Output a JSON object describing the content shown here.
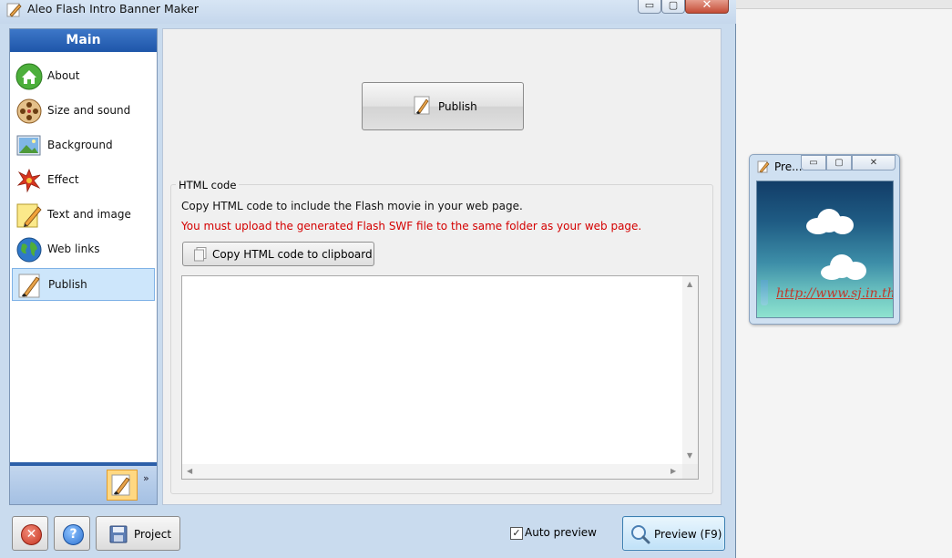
{
  "window": {
    "title": "Aleo Flash Intro Banner Maker",
    "min_glyph": "▭",
    "max_glyph": "▢",
    "close_glyph": "✕"
  },
  "nav": {
    "header": "Main",
    "items": [
      {
        "label": "About",
        "icon": "home-icon"
      },
      {
        "label": "Size and sound",
        "icon": "film-reel-icon"
      },
      {
        "label": "Background",
        "icon": "picture-icon"
      },
      {
        "label": "Effect",
        "icon": "splash-icon"
      },
      {
        "label": "Text and image",
        "icon": "pencil-note-icon"
      },
      {
        "label": "Web links",
        "icon": "globe-icon"
      },
      {
        "label": "Publish",
        "icon": "brush-icon",
        "selected": true
      }
    ],
    "chevron": "»"
  },
  "content": {
    "publish_label": "Publish",
    "html_group_title": "HTML code",
    "copy_instruction": "Copy HTML code to include the Flash movie in your web page.",
    "upload_warning": "You must upload the generated Flash SWF file to the same folder as your web page.",
    "copy_button_label": "Copy HTML code to clipboard",
    "code_text": ""
  },
  "bottom": {
    "project_label": "Project",
    "auto_preview_label": "Auto preview",
    "auto_preview_checked": true,
    "preview_label": "Preview (F9)",
    "exit_glyph": "✕",
    "help_glyph": "?"
  },
  "preview_window": {
    "title": "Pre...",
    "link_text": "http://www.sj.in.th"
  },
  "colors": {
    "nav_header": "#1e56a9",
    "warning_text": "#d40000",
    "selected_item": "#cde6fb",
    "link": "#c0392b"
  }
}
